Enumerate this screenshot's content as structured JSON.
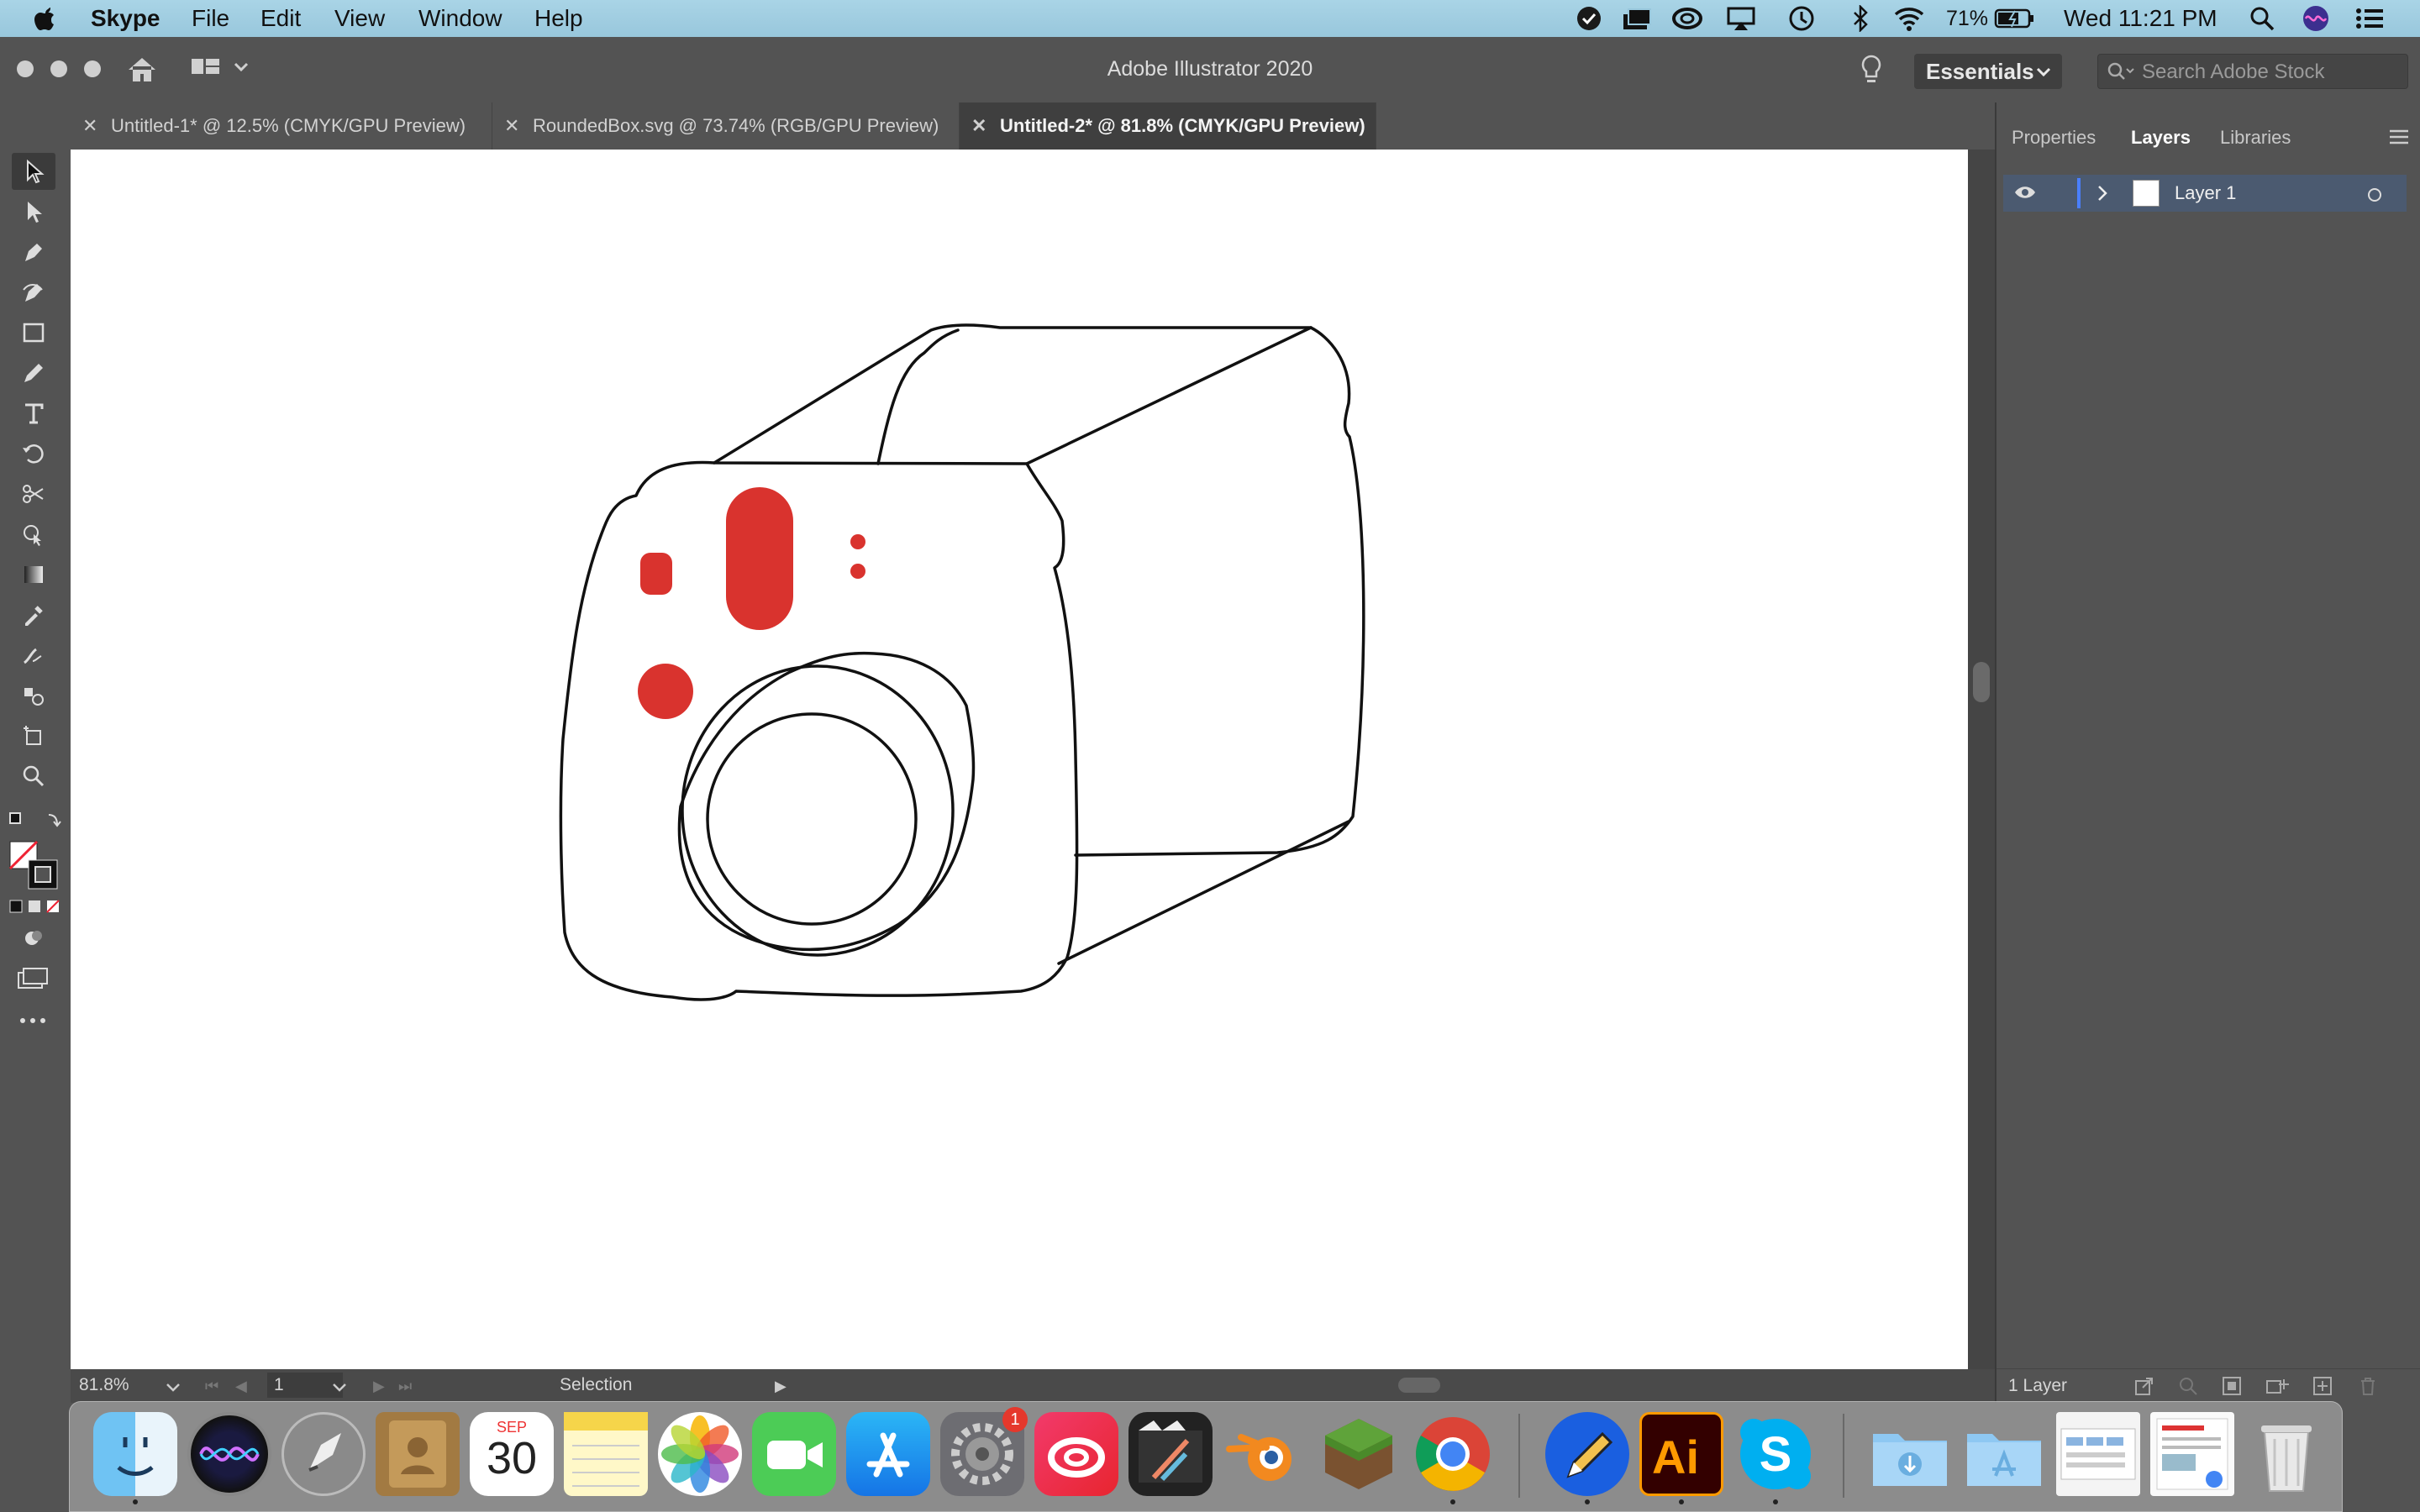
{
  "menubar": {
    "app_name": "Skype",
    "menus": [
      "File",
      "Edit",
      "View",
      "Window",
      "Help"
    ],
    "battery": "71%",
    "clock": "Wed 11:21 PM"
  },
  "app": {
    "title": "Adobe Illustrator 2020",
    "workspace": "Essentials",
    "stock_search_placeholder": "Search Adobe Stock"
  },
  "tabs": [
    {
      "label": "Untitled-1* @ 12.5% (CMYK/GPU Preview)",
      "active": false
    },
    {
      "label": "RoundedBox.svg @ 73.74% (RGB/GPU Preview)",
      "active": false
    },
    {
      "label": "Untitled-2* @ 81.8% (CMYK/GPU Preview)",
      "active": true
    }
  ],
  "toolbar": {
    "tools": [
      "selection-tool-icon",
      "direct-selection-tool-icon",
      "pen-tool-icon",
      "curvature-tool-icon",
      "rectangle-tool-icon",
      "pencil-tool-icon",
      "type-tool-icon",
      "rotate-tool-icon",
      "scissors-tool-icon",
      "shape-builder-tool-icon",
      "gradient-tool-icon",
      "eyedropper-tool-icon",
      "width-tool-icon",
      "symbol-sprayer-tool-icon",
      "artboard-tool-icon",
      "zoom-tool-icon"
    ]
  },
  "status": {
    "zoom": "81.8%",
    "page": "1",
    "tool": "Selection"
  },
  "panel": {
    "tabs": [
      "Properties",
      "Layers",
      "Libraries"
    ],
    "active_tab": "Layers",
    "layers": [
      {
        "name": "Layer 1"
      }
    ],
    "footer": "1 Layer"
  },
  "calendar": {
    "month": "SEP",
    "day": "30"
  },
  "dock": {
    "apps": [
      "Finder",
      "Siri",
      "Launchpad",
      "Contacts",
      "Calendar",
      "Notes",
      "Photos",
      "FaceTime",
      "App Store",
      "System Preferences",
      "Creative Cloud",
      "Final Cut Pro",
      "Blender",
      "Minecraft",
      "Google Chrome",
      "Sketchbook",
      "Adobe Illustrator",
      "Skype",
      "Downloads",
      "Applications",
      "Screenshot",
      "Document",
      "Trash"
    ],
    "system_preferences_badge": "1"
  },
  "colors": {
    "accent_red": "#d9332e",
    "selection_blue": "#4a7fff",
    "ui_gray": "#535353"
  }
}
